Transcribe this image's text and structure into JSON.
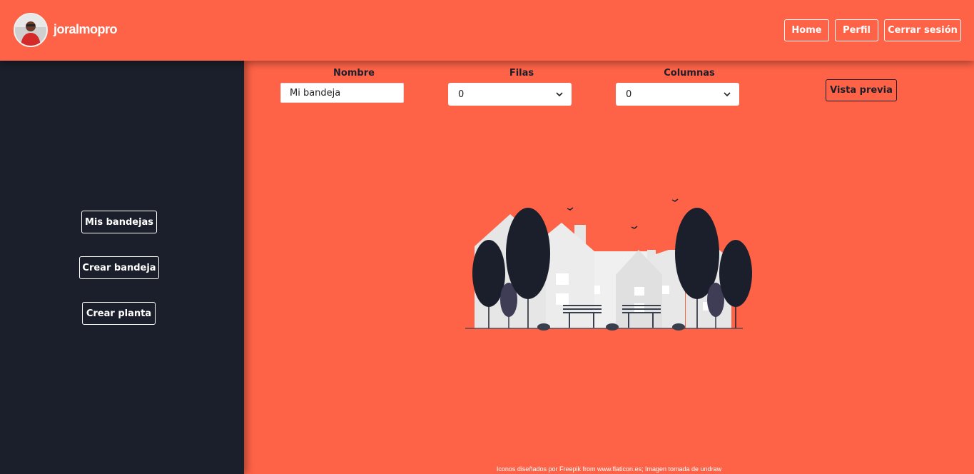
{
  "header": {
    "username": "joralmopro",
    "nav": [
      {
        "label": "Home"
      },
      {
        "label": "Perfil"
      },
      {
        "label": "Cerrar sesión"
      }
    ]
  },
  "sidebar": {
    "items": [
      {
        "label": "Mis bandejas"
      },
      {
        "label": "Crear bandeja"
      },
      {
        "label": "Crear planta"
      }
    ]
  },
  "form": {
    "nombre_label": "Nombre",
    "nombre_value": "Mi bandeja",
    "filas_label": "Filas",
    "filas_value": "0",
    "columnas_label": "Columnas",
    "columnas_value": "0",
    "preview_label": "Vista previa"
  },
  "footer": {
    "text": "Iconos diseñados por Freepik from www.flaticon.es; Imagen tomada de undraw"
  },
  "colors": {
    "accent": "#ff6347",
    "sidebar": "#1b1f2b",
    "text_light": "#ffffff"
  },
  "icons": [
    "avatar-photo",
    "chevron-down-icon",
    "neighborhood-illustration"
  ]
}
